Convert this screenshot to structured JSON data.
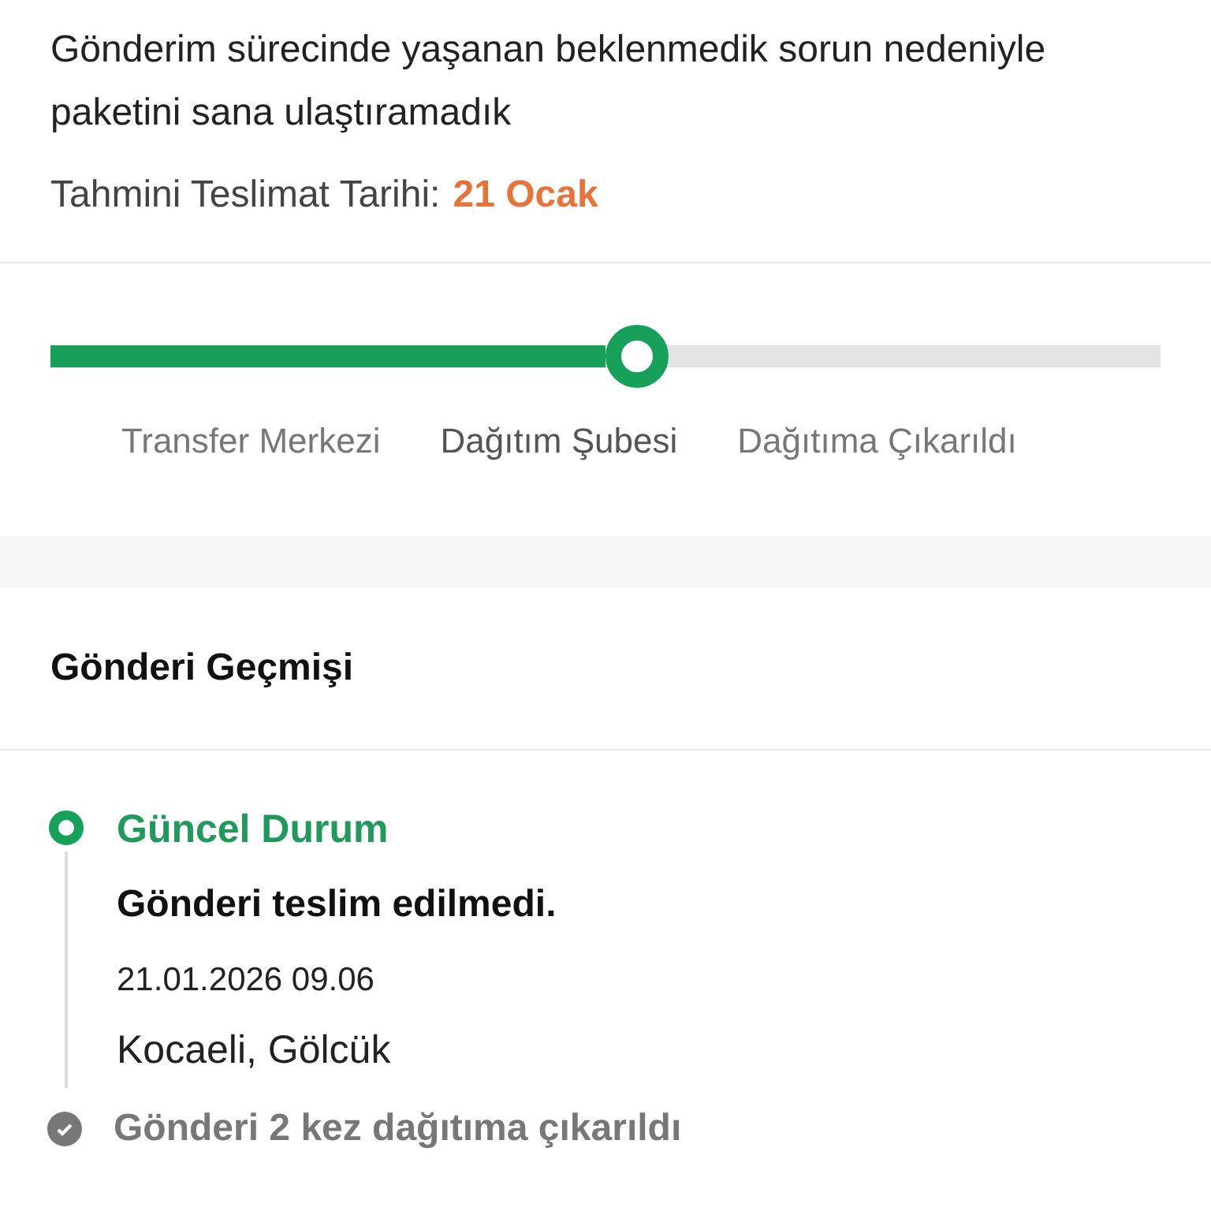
{
  "status": {
    "message": "Gönderim sürecinde yaşanan beklenmedik sorun nedeniyle paketini sana ulaştıramadık",
    "eta_label": "Tahmini Teslimat Tarihi:",
    "eta_value": "21 Ocak"
  },
  "progress": {
    "level": 0.5,
    "steps": [
      {
        "label": "Transfer Merkezi",
        "selected": false
      },
      {
        "label": "Dağıtım Şubesi",
        "selected": true
      },
      {
        "label": "Dağıtıma Çıkarıldı",
        "selected": false
      }
    ]
  },
  "history": {
    "title": "Gönderi Geçmişi",
    "events": [
      {
        "kind": "current",
        "heading": "Güncel Durum",
        "title": "Gönderi teslim edilmedi.",
        "time": "21.01.2026 09.06",
        "location": "Kocaeli, Gölcük"
      },
      {
        "kind": "past",
        "heading": "Gönderi 2 kez dağıtıma çıkarıldı"
      }
    ]
  }
}
